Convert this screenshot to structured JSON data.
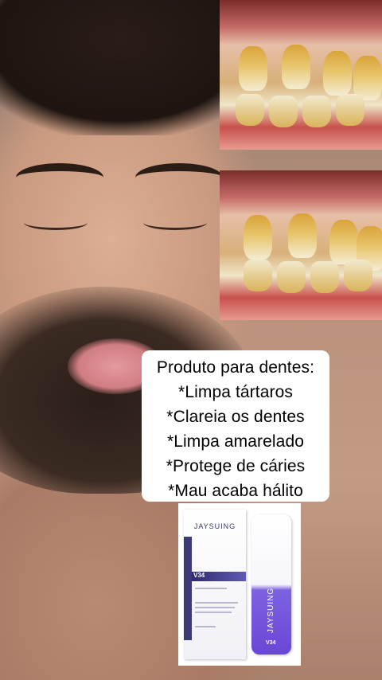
{
  "callout": {
    "lines": [
      "Produto para dentes:",
      "*Limpa tártaros",
      "*Clareia os dentes",
      "*Limpa amarelado",
      "*Protege de cáries",
      "*Mau acaba hálito"
    ]
  },
  "product": {
    "box_brand": "JAYSUING",
    "box_code": "V34",
    "tube_brand": "JAYSUING",
    "tube_code": "V34"
  },
  "colors": {
    "callout_bg": "#ffffff",
    "product_purple": "#6a46d6",
    "tooth_yellow": "#d9a33a"
  }
}
